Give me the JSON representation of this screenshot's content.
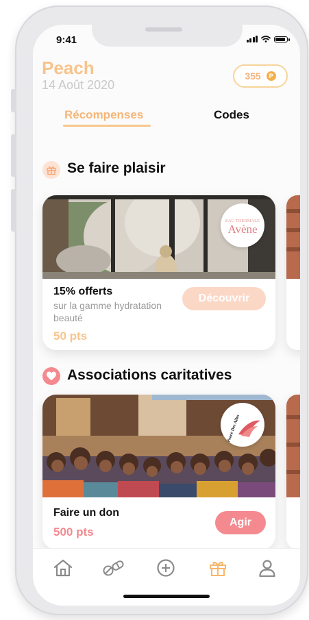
{
  "status_bar": {
    "time": "9:41"
  },
  "header": {
    "user_name": "Peach",
    "date": "14 Août 2020",
    "points": "355",
    "coin_symbol": "P"
  },
  "tabs": [
    {
      "label": "Récompenses",
      "active": true
    },
    {
      "label": "Codes",
      "active": false
    }
  ],
  "sections": [
    {
      "title": "Se faire plaisir",
      "icon": "gift-icon",
      "card": {
        "brand_line1": "EAU THERMALE",
        "brand_line2": "Avène",
        "title": "15% offerts",
        "subtitle": "sur la gamme hydratation beauté",
        "points": "50 pts",
        "cta": "Découvrir"
      }
    },
    {
      "title": "Associations caritatives",
      "icon": "heart-icon",
      "card": {
        "brand_line1": "Peace Des Ailes",
        "title": "Faire un don",
        "points": "500 pts",
        "cta": "Agir"
      }
    }
  ],
  "bottom_nav": [
    "home-icon",
    "pills-icon",
    "plus-circle-icon",
    "gift-icon",
    "profile-icon"
  ],
  "colors": {
    "accent_gold": "#f7c48c",
    "accent_peach": "#f6b678",
    "accent_pink": "#f48a90",
    "cta_peach_light": "#fbd7c6",
    "muted_text": "#9a9a9a"
  }
}
